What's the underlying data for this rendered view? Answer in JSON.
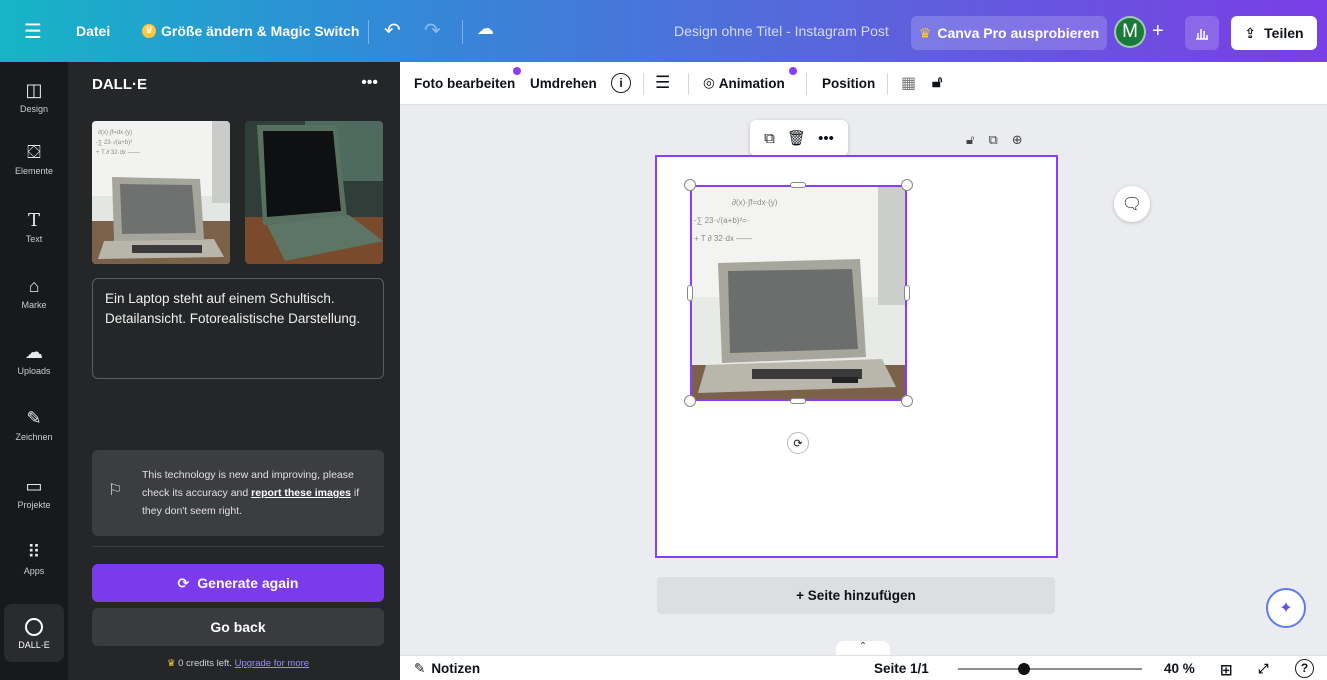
{
  "topbar": {
    "menu_icon": "hamburger-icon",
    "file_label": "Datei",
    "resize_label": "Größe ändern & Magic Switch",
    "design_title": "Design ohne Titel - Instagram Post",
    "pro_label": "Canva Pro ausprobieren",
    "avatar_letter": "M",
    "share_label": "Teilen"
  },
  "rail": {
    "items": [
      {
        "label": "Design",
        "icon": "layout-icon"
      },
      {
        "label": "Elemente",
        "icon": "shapes-icon"
      },
      {
        "label": "Text",
        "icon": "text-icon"
      },
      {
        "label": "Marke",
        "icon": "brand-icon"
      },
      {
        "label": "Uploads",
        "icon": "cloud-upload-icon"
      },
      {
        "label": "Zeichnen",
        "icon": "draw-icon"
      },
      {
        "label": "Projekte",
        "icon": "folder-icon"
      },
      {
        "label": "Apps",
        "icon": "apps-grid-icon"
      }
    ],
    "active_app": "DALL·E"
  },
  "panel": {
    "title": "DALL·E",
    "prompt": "Ein Laptop steht auf einem Schultisch. Detailansicht. Fotorealistische Darstellung.",
    "notice_text_1": "This technology is new and improving, please check its accuracy and ",
    "notice_link": "report these images",
    "notice_text_2": " if they don't seem right.",
    "generate_label": "Generate again",
    "back_label": "Go back",
    "credits_text": "0 credits left.",
    "credits_link": "Upgrade for more"
  },
  "context_toolbar": {
    "edit_photo": "Foto bearbeiten",
    "flip": "Umdrehen",
    "animation": "Animation",
    "position": "Position"
  },
  "canvas": {
    "add_page": "+ Seite hinzufügen"
  },
  "bottom": {
    "notes": "Notizen",
    "page_indicator": "Seite 1/1",
    "zoom": "40 %",
    "zoom_fraction": 0.4
  },
  "colors": {
    "accent": "#8b3dff",
    "generate_button": "#7c3aed",
    "panel_bg": "#252627",
    "rail_bg": "#18191b"
  }
}
